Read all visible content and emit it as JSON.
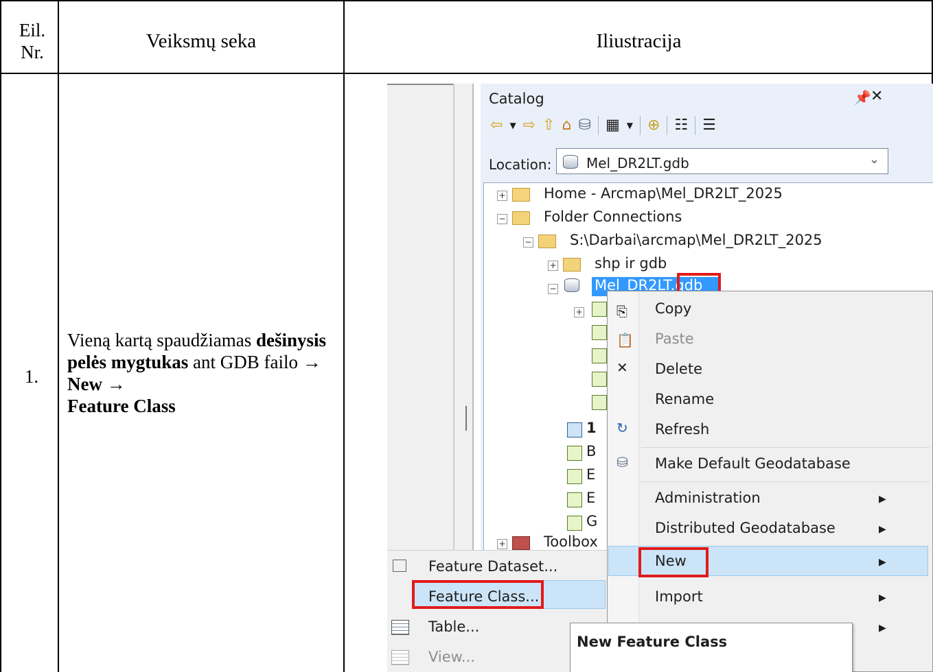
{
  "table": {
    "header_eil_line1": "Eil.",
    "header_eil_line2": "Nr.",
    "header_steps": "Veiksmų seka",
    "header_illustration": "Iliustracija",
    "row1_number": "1.",
    "row1_text_1": "Vieną kartą spaudžiamas ",
    "row1_text_2": "dešinysis pelės mygtukas",
    "row1_text_3": " ant GDB failo → ",
    "row1_text_4": "New",
    "row1_text_5": " → ",
    "row1_text_6": "Feature Class"
  },
  "catalog": {
    "title": "Catalog",
    "location_label": "Location:",
    "location_value": "Mel_DR2LT.gdb",
    "tree": {
      "home": "Home - Arcmap\\Mel_DR2LT_2025",
      "folder_connections": "Folder Connections",
      "folder_path": "S:\\Darbai\\arcmap\\Mel_DR2LT_2025",
      "shp_folder": "shp ir gdb",
      "gdb_selected": "Mel_DR2LT.gdb",
      "child_1": "1",
      "child_b": "B",
      "child_e1": "E",
      "child_e2": "E",
      "child_g": "G",
      "toolboxes": "Toolbox"
    }
  },
  "context_menu": {
    "items": {
      "copy": "Copy",
      "paste": "Paste",
      "delete": "Delete",
      "rename": "Rename",
      "refresh": "Refresh",
      "make_default": "Make Default Geodatabase",
      "administration": "Administration",
      "distributed": "Distributed Geodatabase",
      "new": "New",
      "import": "Import"
    }
  },
  "submenu": {
    "feature_dataset": "Feature Dataset...",
    "feature_class": "Feature Class...",
    "table": "Table...",
    "view": "View..."
  },
  "tooltip": {
    "title": "New Feature Class"
  },
  "colors": {
    "highlight_red": "#e01b1b",
    "selection_blue": "#3399ff",
    "menu_highlight": "#cce4f7"
  }
}
